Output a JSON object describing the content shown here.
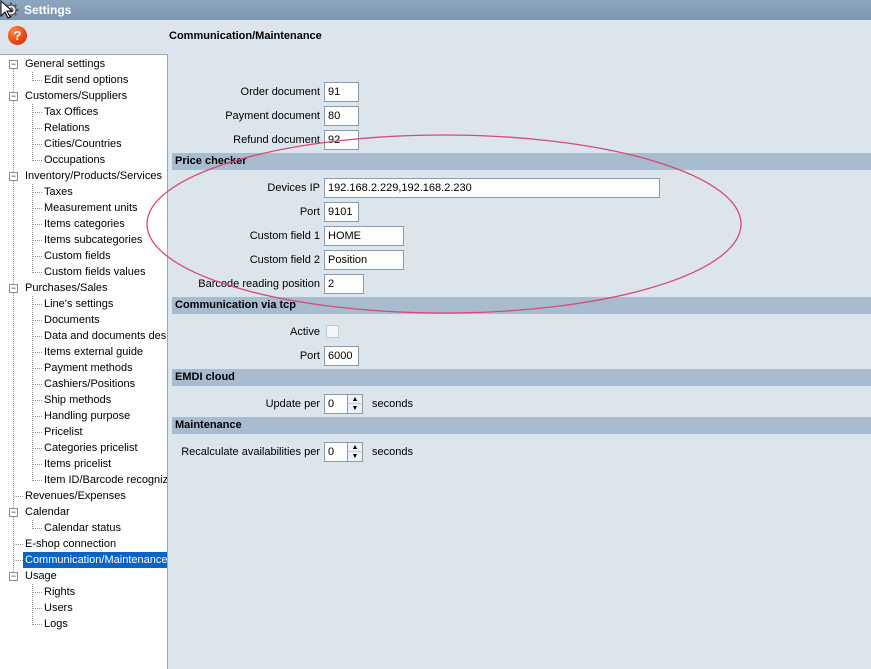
{
  "window": {
    "title": "Settings",
    "gear_icon": "gear-icon",
    "cursor_icon": "mouse-cursor-icon"
  },
  "help": {
    "label": "?"
  },
  "section_heading": "Communication/Maintenance",
  "tree": {
    "general": "General settings",
    "edit_send": "Edit send options",
    "customers": "Customers/Suppliers",
    "tax_offices": "Tax Offices",
    "relations": "Relations",
    "cities": "Cities/Countries",
    "occupations": "Occupations",
    "inventory": "Inventory/Products/Services",
    "taxes": "Taxes",
    "measurement": "Measurement units",
    "items_categories": "Items categories",
    "items_subcategories": "Items subcategories",
    "custom_fields": "Custom fields",
    "custom_fields_values": "Custom fields values",
    "purchases": "Purchases/Sales",
    "lines_settings": "Line's settings",
    "documents": "Documents",
    "data_documents": "Data and documents desi",
    "items_external": "Items external guide",
    "payment_methods": "Payment methods",
    "cashiers": "Cashiers/Positions",
    "ship_methods": "Ship methods",
    "handling_purpose": "Handling purpose",
    "pricelist": "Pricelist",
    "categories_pricelist": "Categories pricelist",
    "items_pricelist": "Items pricelist",
    "item_id_barcode": "Item ID/Barcode recognize",
    "revenues": "Revenues/Expenses",
    "calendar": "Calendar",
    "calendar_status": "Calendar status",
    "eshop": "E-shop connection",
    "communication": "Communication/Maintenance",
    "usage": "Usage",
    "rights": "Rights",
    "users": "Users",
    "logs": "Logs"
  },
  "documents": {
    "order_label": "Order document",
    "order_value": "91",
    "payment_label": "Payment document",
    "payment_value": "80",
    "refund_label": "Refund document",
    "refund_value": "92"
  },
  "price_checker": {
    "heading": "Price checker",
    "devices_ip_label": "Devices IP",
    "devices_ip_value": "192.168.2.229,192.168.2.230",
    "port_label": "Port",
    "port_value": "9101",
    "custom1_label": "Custom field 1",
    "custom1_value": "HOME",
    "custom2_label": "Custom field 2",
    "custom2_value": "Position",
    "barcode_pos_label": "Barcode reading position",
    "barcode_pos_value": "2"
  },
  "tcp": {
    "heading": "Communication via tcp",
    "active_label": "Active",
    "active_checked": false,
    "port_label": "Port",
    "port_value": "6000"
  },
  "cloud": {
    "heading": "EMDI cloud",
    "update_label": "Update per",
    "update_value": "0",
    "unit": "seconds"
  },
  "maintenance": {
    "heading": "Maintenance",
    "recalc_label": "Recalculate availabilities per",
    "recalc_value": "0",
    "unit": "seconds"
  },
  "colors": {
    "annotation_ellipse": "#d64a78",
    "selection": "#0a64c8",
    "band": "#a8bccf"
  }
}
